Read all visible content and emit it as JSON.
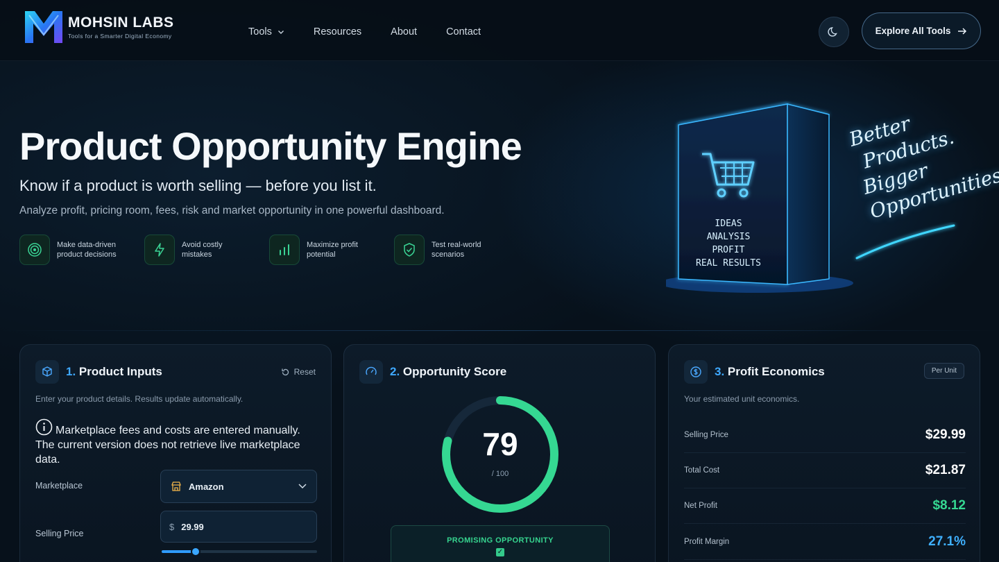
{
  "brand": {
    "name": "MOHSIN LABS",
    "tagline": "Tools for a Smarter Digital Economy"
  },
  "nav": {
    "links": [
      "Tools",
      "Resources",
      "About",
      "Contact"
    ],
    "cta": "Explore All Tools"
  },
  "hero": {
    "title": "Product Opportunity Engine",
    "subtitle": "Know if a product is worth selling — before you list it.",
    "description": "Analyze profit, pricing room, fees, risk and market opportunity in one powerful dashboard.",
    "features": [
      {
        "label": "Make data-driven product decisions",
        "icon": "target-icon"
      },
      {
        "label": "Avoid costly mistakes",
        "icon": "lightning-icon"
      },
      {
        "label": "Maximize profit potential",
        "icon": "bar-chart-icon"
      },
      {
        "label": "Test real-world scenarios",
        "icon": "shield-check-icon"
      }
    ],
    "art": {
      "box_lines": [
        "IDEAS",
        "ANALYSIS",
        "PROFIT",
        "REAL RESULTS"
      ],
      "script_lines": [
        "Better",
        "Products.",
        "Bigger",
        "Opportunities."
      ]
    }
  },
  "inputs_card": {
    "number": "1.",
    "title": "Product Inputs",
    "reset_label": "Reset",
    "subtitle": "Enter your product details. Results update automatically.",
    "notice": "Marketplace fees and costs are entered manually. The current version does not retrieve live marketplace data.",
    "marketplace_label": "Marketplace",
    "marketplace_value": "Amazon",
    "price_label": "Selling Price",
    "price_currency": "$",
    "price_value": "29.99",
    "price_slider_fraction": 0.22
  },
  "score_card": {
    "number": "2.",
    "title": "Opportunity Score",
    "score": "79",
    "score_max": "/ 100",
    "score_fraction": 0.79,
    "verdict": "PROMISING OPPORTUNITY"
  },
  "economics_card": {
    "number": "3.",
    "title": "Profit Economics",
    "badge": "Per Unit",
    "subtitle": "Your estimated unit economics.",
    "rows": [
      {
        "label": "Selling Price",
        "value": "$29.99",
        "tone": "white"
      },
      {
        "label": "Total Cost",
        "value": "$21.87",
        "tone": "white"
      },
      {
        "label": "Net Profit",
        "value": "$8.12",
        "tone": "green"
      },
      {
        "label": "Profit Margin",
        "value": "27.1%",
        "tone": "blue"
      }
    ]
  },
  "colors": {
    "background": "#07111b",
    "accent_blue": "#3fa9ff",
    "accent_green": "#35d892"
  }
}
